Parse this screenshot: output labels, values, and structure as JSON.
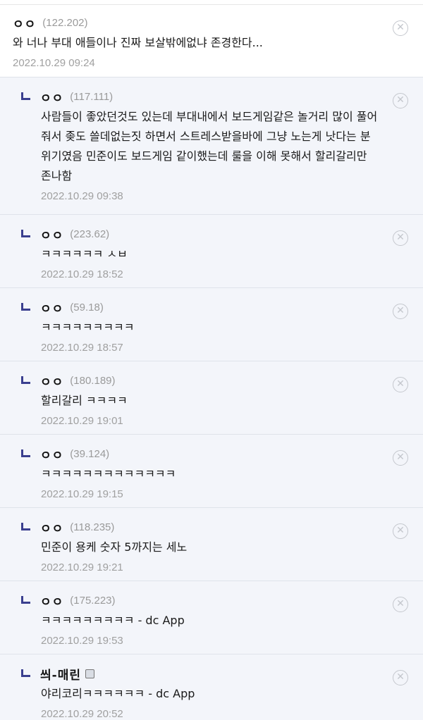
{
  "comments": [
    {
      "nick": "ㅇㅇ",
      "ip": "(122.202)",
      "text": "와 너나 부대 애들이나 진짜 보살밖에없냐 존경한다...",
      "date": "2022.10.29 09:24",
      "reply": false
    },
    {
      "nick": "ㅇㅇ",
      "ip": "(117.111)",
      "text": "사람들이 좋았던것도 있는데 부대내에서 보드게임같은 놀거리 많이 풀어줘서 좆도 쓸데없는짓 하면서 스트레스받을바에 그냥 노는게 낫다는 분위기였음 민준이도 보드게임 같이했는데 룰을 이해 못해서 할리갈리만 존나함",
      "date": "2022.10.29 09:38",
      "reply": true
    },
    {
      "nick": "ㅇㅇ",
      "ip": "(223.62)",
      "text": "ㅋㅋㅋㅋㅋㅋ ㅅㅂ",
      "date": "2022.10.29 18:52",
      "reply": true
    },
    {
      "nick": "ㅇㅇ",
      "ip": "(59.18)",
      "text": "ㅋㅋㅋㅋㅋㅋㅋㅋㅋ",
      "date": "2022.10.29 18:57",
      "reply": true
    },
    {
      "nick": "ㅇㅇ",
      "ip": "(180.189)",
      "text": "할리갈리 ㅋㅋㅋㅋ",
      "date": "2022.10.29 19:01",
      "reply": true
    },
    {
      "nick": "ㅇㅇ",
      "ip": "(39.124)",
      "text": "ㅋㅋㅋㅋㅋㅋㅋㅋㅋㅋㅋㅋㅋ",
      "date": "2022.10.29 19:15",
      "reply": true
    },
    {
      "nick": "ㅇㅇ",
      "ip": "(118.235)",
      "text": "민준이 용케 숫자 5까지는 세노",
      "date": "2022.10.29 19:21",
      "reply": true
    },
    {
      "nick": "ㅇㅇ",
      "ip": "(175.223)",
      "text": "ㅋㅋㅋㅋㅋㅋㅋㅋㅋ - dc App",
      "date": "2022.10.29 19:53",
      "reply": true
    },
    {
      "nick": "씌-매린",
      "ip": "",
      "text": "야리코리ㅋㅋㅋㅋㅋㅋ - dc App",
      "date": "2022.10.29 20:52",
      "reply": true,
      "badge": true
    }
  ],
  "delete_icon": "circle-x-icon",
  "colors": {
    "reply_bg": "#f3f5fa",
    "reply_mark": "#3a3f8f",
    "meta": "#a0a0a0"
  }
}
